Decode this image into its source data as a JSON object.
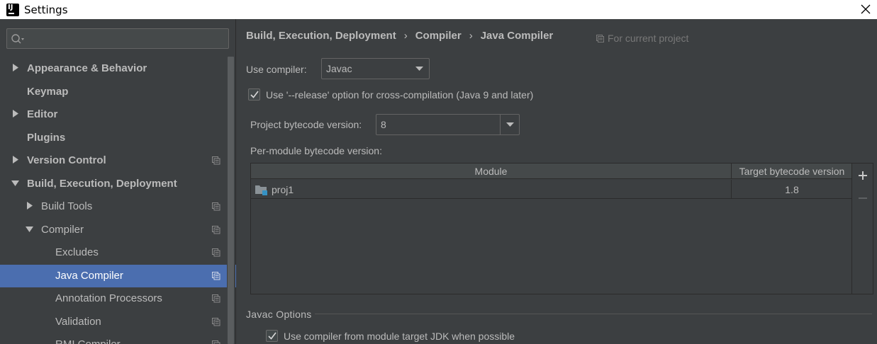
{
  "window": {
    "title": "Settings"
  },
  "sidebar": {
    "search": {
      "value": "",
      "placeholder": ""
    },
    "items": [
      {
        "label": "Appearance & Behavior",
        "bold": true,
        "arrow": "right",
        "indent": 0,
        "project_icon": false
      },
      {
        "label": "Keymap",
        "bold": true,
        "arrow": "none",
        "indent": 0,
        "project_icon": false
      },
      {
        "label": "Editor",
        "bold": true,
        "arrow": "right",
        "indent": 0,
        "project_icon": false
      },
      {
        "label": "Plugins",
        "bold": true,
        "arrow": "none",
        "indent": 0,
        "project_icon": false
      },
      {
        "label": "Version Control",
        "bold": true,
        "arrow": "right",
        "indent": 0,
        "project_icon": true
      },
      {
        "label": "Build, Execution, Deployment",
        "bold": true,
        "arrow": "down",
        "indent": 0,
        "project_icon": false
      },
      {
        "label": "Build Tools",
        "bold": false,
        "arrow": "right",
        "indent": 1,
        "project_icon": true
      },
      {
        "label": "Compiler",
        "bold": false,
        "arrow": "down",
        "indent": 1,
        "project_icon": true
      },
      {
        "label": "Excludes",
        "bold": false,
        "arrow": "none",
        "indent": 2,
        "project_icon": true
      },
      {
        "label": "Java Compiler",
        "bold": false,
        "arrow": "none",
        "indent": 2,
        "project_icon": true,
        "selected": true
      },
      {
        "label": "Annotation Processors",
        "bold": false,
        "arrow": "none",
        "indent": 2,
        "project_icon": true
      },
      {
        "label": "Validation",
        "bold": false,
        "arrow": "none",
        "indent": 2,
        "project_icon": true
      },
      {
        "label": "RMI Compiler",
        "bold": false,
        "arrow": "none",
        "indent": 2,
        "project_icon": true
      }
    ]
  },
  "content": {
    "breadcrumb": [
      "Build, Execution, Deployment",
      "Compiler",
      "Java Compiler"
    ],
    "breadcrumb_separator": "›",
    "for_current_project": "For current project",
    "use_compiler": {
      "label": "Use compiler:",
      "value": "Javac"
    },
    "release_option": {
      "label": "Use '--release' option for cross-compilation (Java 9 and later)",
      "checked": true
    },
    "project_bytecode": {
      "label": "Project bytecode version:",
      "value": "8"
    },
    "per_module_label": "Per-module bytecode version:",
    "table": {
      "columns": [
        "Module",
        "Target bytecode version"
      ],
      "rows": [
        {
          "module": "proj1",
          "target": "1.8"
        }
      ]
    },
    "toolbar": {
      "add": "+",
      "remove": "−"
    },
    "javac_options": {
      "title": "Javac Options",
      "use_module_jdk": {
        "label": "Use compiler from module target JDK when possible",
        "checked": true
      }
    }
  },
  "colors": {
    "background": "#3c3f41",
    "selection": "#4b6eaf",
    "text": "#bbbbbb",
    "dim_text": "#787878",
    "module_badge": "#3592c4"
  }
}
